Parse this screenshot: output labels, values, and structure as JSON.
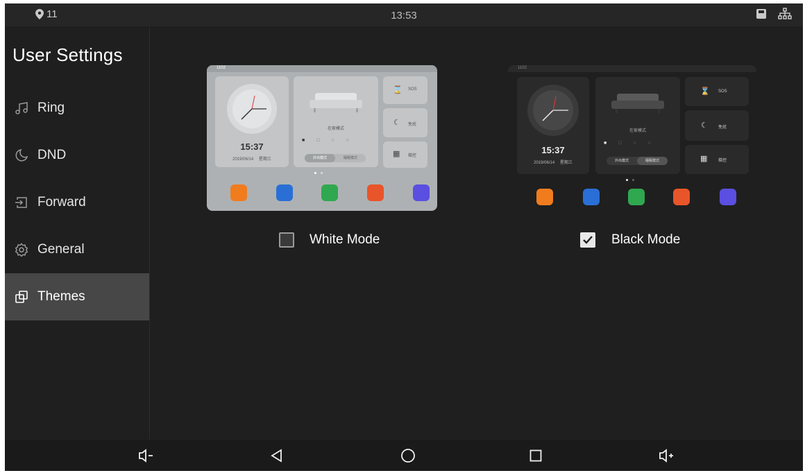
{
  "status_bar": {
    "location_count": "11",
    "time": "13:53"
  },
  "sidebar": {
    "title": "User Settings",
    "items": [
      {
        "label": "Ring",
        "icon": "music-note-icon"
      },
      {
        "label": "DND",
        "icon": "moon-icon"
      },
      {
        "label": "Forward",
        "icon": "forward-icon"
      },
      {
        "label": "General",
        "icon": "gear-icon"
      },
      {
        "label": "Themes",
        "icon": "themes-icon",
        "active": true
      }
    ]
  },
  "themes": {
    "white": {
      "label": "White Mode",
      "checked": false,
      "preview": {
        "status": "1102",
        "clock_time": "15:37",
        "date": "2019/06/14",
        "weekday": "星期三",
        "scene_label": "在家模式",
        "sos": "SOS",
        "dnd": "免扰",
        "elevator": "梯控",
        "mode_a": "外出模式",
        "mode_b": "睡眠模式"
      }
    },
    "black": {
      "label": "Black Mode",
      "checked": true,
      "preview": {
        "status": "1102",
        "clock_time": "15:37",
        "date": "2019/06/14",
        "weekday": "星期三",
        "scene_label": "在家模式",
        "sos": "SOS",
        "dnd": "免扰",
        "elevator": "梯控",
        "mode_a": "外出模式",
        "mode_b": "睡眠模式"
      }
    }
  },
  "app_colors": [
    "#f07c1e",
    "#2a6fd6",
    "#2fa84f",
    "#e8552a",
    "#5a4fe0"
  ],
  "nav_bar": [
    "volume-down-icon",
    "back-icon",
    "home-icon",
    "recents-icon",
    "volume-up-icon"
  ]
}
